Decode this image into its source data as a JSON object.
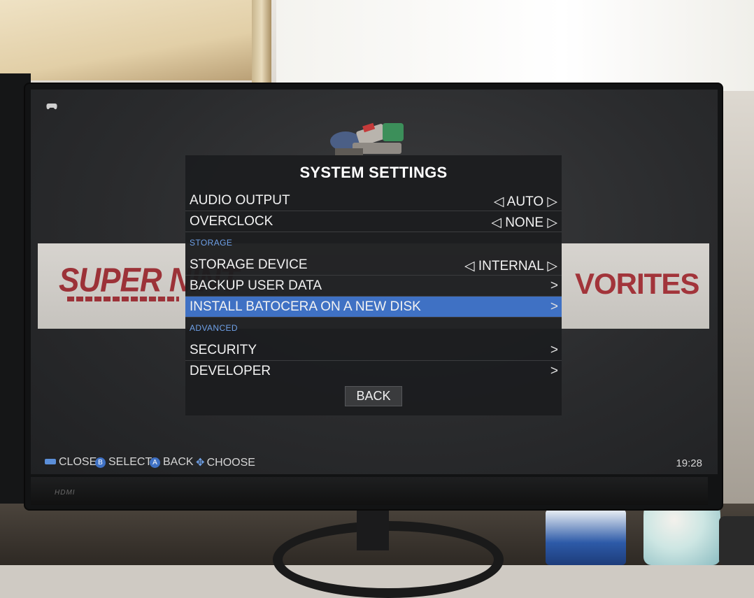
{
  "dialog": {
    "title": "SYSTEM SETTINGS",
    "rows": [
      {
        "label": "AUDIO OUTPUT",
        "value": "◁ AUTO ▷"
      },
      {
        "label": "OVERCLOCK",
        "value": "◁ NONE ▷"
      },
      {
        "label": "STORAGE DEVICE",
        "value": "◁ INTERNAL ▷"
      },
      {
        "label": "BACKUP USER DATA",
        "value": ">"
      },
      {
        "label": "INSTALL BATOCERA ON A NEW DISK",
        "value": ">",
        "selected": true
      },
      {
        "label": "SECURITY",
        "value": ">"
      },
      {
        "label": "DEVELOPER",
        "value": ">"
      }
    ],
    "sections": {
      "storage": "STORAGE",
      "advanced": "ADVANCED"
    },
    "back_label": "BACK"
  },
  "background": {
    "banner_left_text": "SUPER NINT",
    "banner_right_text": "VORITES"
  },
  "footer": {
    "close": "CLOSE",
    "select": "SELECT",
    "back": "BACK",
    "choose": "CHOOSE",
    "b_button": "B",
    "a_button": "A",
    "clock": "19:28"
  },
  "monitor": {
    "brand_label": "HDMI"
  },
  "colors": {
    "selection": "#3f71c4",
    "section_header": "#6fa1e8",
    "dialog_bg": "#1c1d1f"
  }
}
